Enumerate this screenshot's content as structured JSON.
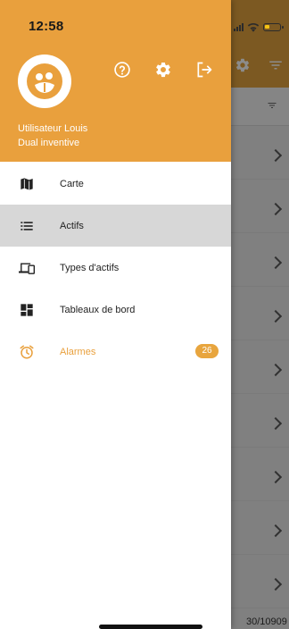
{
  "status_bar": {
    "time": "12:58",
    "signal_icon": "cellular-signal-icon",
    "wifi_icon": "wifi-icon",
    "battery_icon": "battery-icon",
    "battery_color": "#f3c315"
  },
  "drawer": {
    "accent_color": "#e9a03d",
    "header_icons": {
      "help": "help-circle-icon",
      "settings": "gear-icon",
      "logout": "logout-icon"
    },
    "user": {
      "avatar_icon": "avatar-logo-icon",
      "name": "Utilisateur Louis",
      "organization": "Dual inventive"
    },
    "menu": [
      {
        "label": "Carte",
        "icon": "map-icon",
        "active": false
      },
      {
        "label": "Actifs",
        "icon": "list-icon",
        "active": true
      },
      {
        "label": "Types d'actifs",
        "icon": "devices-icon",
        "active": false
      },
      {
        "label": "Tableaux de bord",
        "icon": "dashboard-icon",
        "active": false
      },
      {
        "label": "Alarmes",
        "icon": "alarm-clock-icon",
        "active": false,
        "badge": "26"
      }
    ]
  },
  "background_app": {
    "header_icons": [
      "gear-icon",
      "filter-icon"
    ],
    "sort_icon": "sort-icon",
    "row_chevron_icon": "chevron-right-icon",
    "footer_text": "30/10909"
  }
}
